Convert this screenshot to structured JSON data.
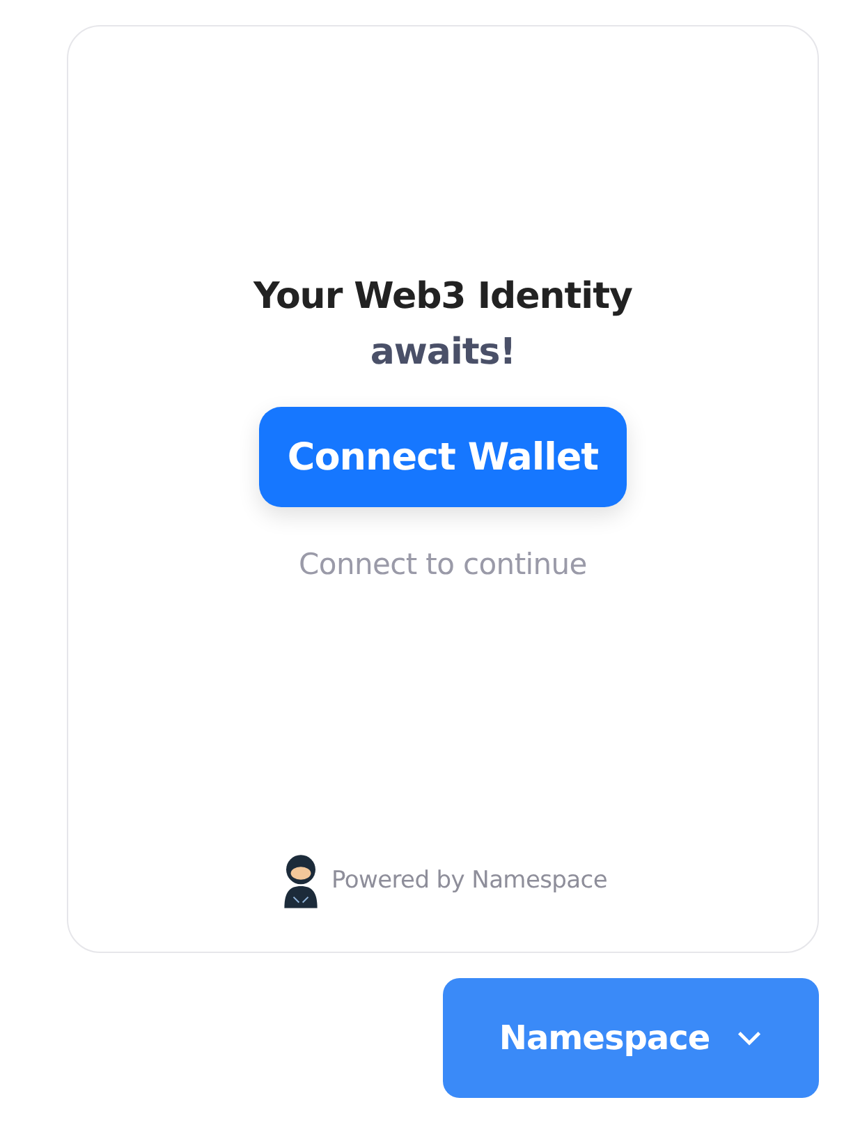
{
  "card": {
    "heading": "Your Web3 Identity",
    "subheading": "awaits!",
    "connect_button": "Connect Wallet",
    "hint": "Connect to continue",
    "footer": "Powered by Namespace"
  },
  "menu_button": {
    "label": "Namespace",
    "expanded": false
  }
}
